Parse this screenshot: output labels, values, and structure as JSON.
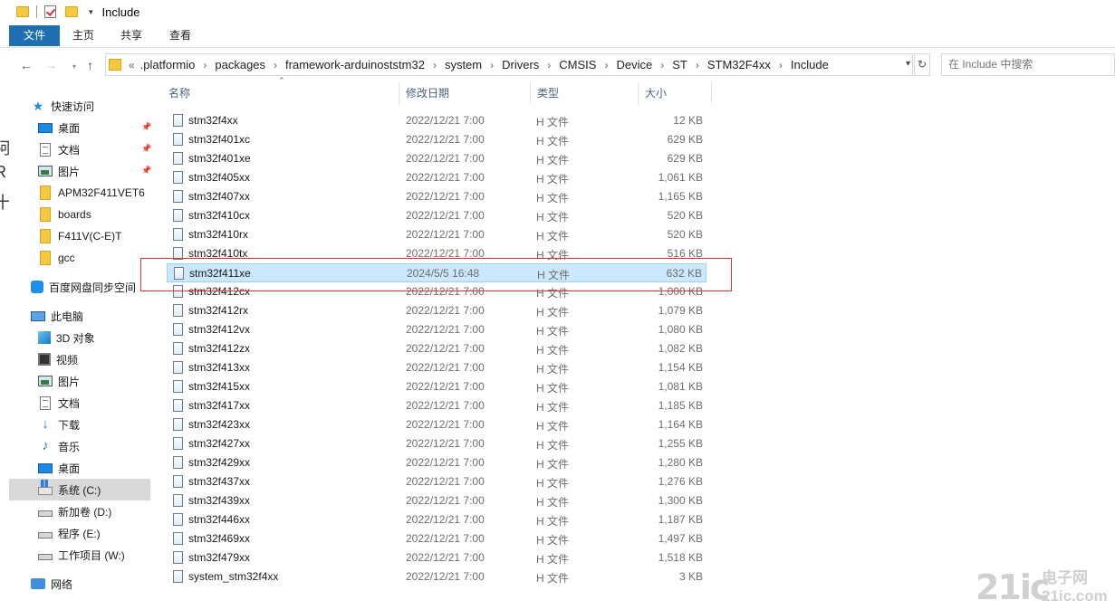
{
  "titlebar": {
    "title": "Include"
  },
  "ribbon": {
    "tabs": [
      "文件",
      "主页",
      "共享",
      "查看"
    ]
  },
  "address": {
    "overflow": "«",
    "crumbs": [
      ".platformio",
      "packages",
      "framework-arduinoststm32",
      "system",
      "Drivers",
      "CMSIS",
      "Device",
      "ST",
      "STM32F4xx",
      "Include"
    ],
    "search_placeholder": "在 Include 中搜索"
  },
  "nav": {
    "quick_access": "快速访问",
    "quick_items": [
      "桌面",
      "文档",
      "图片",
      "APM32F411VET6",
      "boards",
      "F411V(C-E)T",
      "gcc"
    ],
    "baidu": "百度网盘同步空间",
    "this_pc": "此电脑",
    "pc_items": [
      "3D 对象",
      "视频",
      "图片",
      "文档",
      "下载",
      "音乐",
      "桌面",
      "系统 (C:)",
      "新加卷 (D:)",
      "程序 (E:)",
      "工作项目 (W:)"
    ],
    "network": "网络"
  },
  "columns": {
    "name": "名称",
    "date": "修改日期",
    "type": "类型",
    "size": "大小"
  },
  "files": [
    {
      "name": "stm32f4xx",
      "date": "2022/12/21 7:00",
      "type": "H 文件",
      "size": "12 KB"
    },
    {
      "name": "stm32f401xc",
      "date": "2022/12/21 7:00",
      "type": "H 文件",
      "size": "629 KB"
    },
    {
      "name": "stm32f401xe",
      "date": "2022/12/21 7:00",
      "type": "H 文件",
      "size": "629 KB"
    },
    {
      "name": "stm32f405xx",
      "date": "2022/12/21 7:00",
      "type": "H 文件",
      "size": "1,061 KB"
    },
    {
      "name": "stm32f407xx",
      "date": "2022/12/21 7:00",
      "type": "H 文件",
      "size": "1,165 KB"
    },
    {
      "name": "stm32f410cx",
      "date": "2022/12/21 7:00",
      "type": "H 文件",
      "size": "520 KB"
    },
    {
      "name": "stm32f410rx",
      "date": "2022/12/21 7:00",
      "type": "H 文件",
      "size": "520 KB"
    },
    {
      "name": "stm32f410tx",
      "date": "2022/12/21 7:00",
      "type": "H 文件",
      "size": "516 KB"
    },
    {
      "name": "stm32f411xe",
      "date": "2024/5/5 16:48",
      "type": "H 文件",
      "size": "632 KB",
      "selected": true
    },
    {
      "name": "stm32f412cx",
      "date": "2022/12/21 7:00",
      "type": "H 文件",
      "size": "1,000 KB"
    },
    {
      "name": "stm32f412rx",
      "date": "2022/12/21 7:00",
      "type": "H 文件",
      "size": "1,079 KB"
    },
    {
      "name": "stm32f412vx",
      "date": "2022/12/21 7:00",
      "type": "H 文件",
      "size": "1,080 KB"
    },
    {
      "name": "stm32f412zx",
      "date": "2022/12/21 7:00",
      "type": "H 文件",
      "size": "1,082 KB"
    },
    {
      "name": "stm32f413xx",
      "date": "2022/12/21 7:00",
      "type": "H 文件",
      "size": "1,154 KB"
    },
    {
      "name": "stm32f415xx",
      "date": "2022/12/21 7:00",
      "type": "H 文件",
      "size": "1,081 KB"
    },
    {
      "name": "stm32f417xx",
      "date": "2022/12/21 7:00",
      "type": "H 文件",
      "size": "1,185 KB"
    },
    {
      "name": "stm32f423xx",
      "date": "2022/12/21 7:00",
      "type": "H 文件",
      "size": "1,164 KB"
    },
    {
      "name": "stm32f427xx",
      "date": "2022/12/21 7:00",
      "type": "H 文件",
      "size": "1,255 KB"
    },
    {
      "name": "stm32f429xx",
      "date": "2022/12/21 7:00",
      "type": "H 文件",
      "size": "1,280 KB"
    },
    {
      "name": "stm32f437xx",
      "date": "2022/12/21 7:00",
      "type": "H 文件",
      "size": "1,276 KB"
    },
    {
      "name": "stm32f439xx",
      "date": "2022/12/21 7:00",
      "type": "H 文件",
      "size": "1,300 KB"
    },
    {
      "name": "stm32f446xx",
      "date": "2022/12/21 7:00",
      "type": "H 文件",
      "size": "1,187 KB"
    },
    {
      "name": "stm32f469xx",
      "date": "2022/12/21 7:00",
      "type": "H 文件",
      "size": "1,497 KB"
    },
    {
      "name": "stm32f479xx",
      "date": "2022/12/21 7:00",
      "type": "H 文件",
      "size": "1,518 KB"
    },
    {
      "name": "system_stm32f4xx",
      "date": "2022/12/21 7:00",
      "type": "H 文件",
      "size": "3 KB"
    }
  ],
  "watermark": {
    "logo": "21ic",
    "cn": "电子网",
    "url": "21ic.com"
  },
  "colors": {
    "accent": "#1f6fb2",
    "selection": "#cce8ff",
    "annotation": "#e0342e"
  }
}
